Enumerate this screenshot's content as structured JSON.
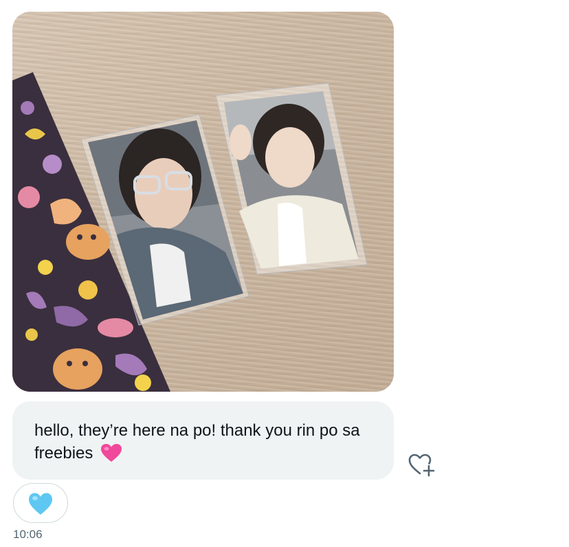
{
  "message": {
    "text": "hello, they’re here na po! thank you rin po sa freebies",
    "emoji": "pink-heart"
  },
  "reaction": {
    "emoji": "light-blue-heart"
  },
  "react_button": {
    "icon": "heart-plus-icon"
  },
  "timestamp": "10:06",
  "colors": {
    "bubble_bg": "#eff3f4",
    "text": "#0f1419",
    "timestamp": "#536471",
    "pill_border": "#cfd9de",
    "pink_heart": "#f0489b",
    "blue_heart": "#5ec8f2"
  }
}
